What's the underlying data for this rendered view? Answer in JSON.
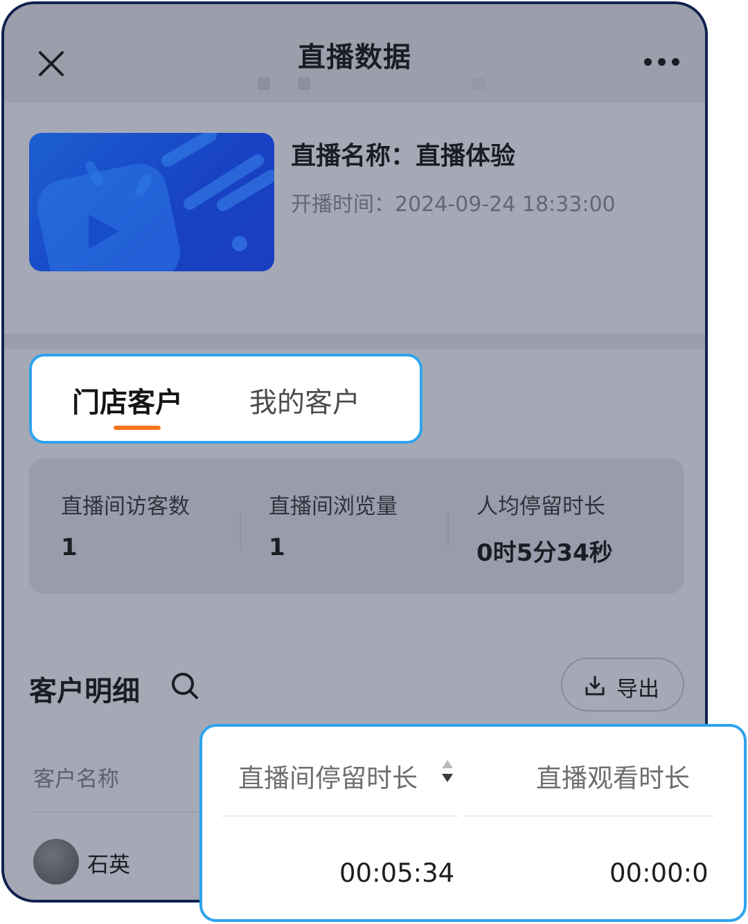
{
  "colors": {
    "accent_tab": "#f5741a",
    "highlight_border": "#2ea3ee",
    "thumbnail_blue": "#1742c4"
  },
  "nav": {
    "title": "直播数据",
    "close_icon": "close-icon",
    "more_icon": "more-icon"
  },
  "live": {
    "name": "直播名称：直播体验",
    "start_time": "开播时间：2024-09-24 18:33:00",
    "thumbnail_icon": "play-video-icon"
  },
  "tabs": [
    {
      "label": "门店客户",
      "active": true
    },
    {
      "label": "我的客户",
      "active": false
    }
  ],
  "stats": [
    {
      "label": "直播间访客数",
      "value": "1"
    },
    {
      "label": "直播间浏览量",
      "value": "1"
    },
    {
      "label": "人均停留时长",
      "value": "0时5分34秒"
    }
  ],
  "detail": {
    "title": "客户明细",
    "search_icon": "search-icon",
    "export_label": "导出",
    "export_icon": "download-icon",
    "columns": {
      "name": "客户名称",
      "stay": "直播间停留时长",
      "watch": "直播观看时长"
    },
    "rows": [
      {
        "name": "石英",
        "stay": "00:05:34",
        "watch": "00:00:0"
      }
    ]
  }
}
